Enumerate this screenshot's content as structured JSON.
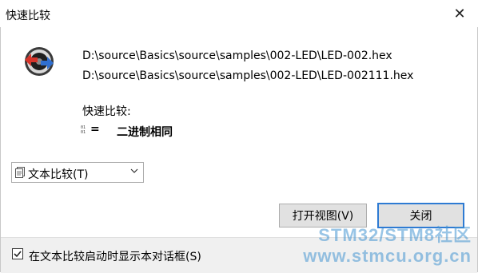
{
  "window": {
    "title": "快速比较",
    "close_glyph": "✕"
  },
  "files": {
    "left": "D:\\source\\Basics\\source\\samples\\002-LED\\LED-002.hex",
    "right": "D:\\source\\Basics\\source\\samples\\002-LED\\LED-002111.hex"
  },
  "summary": {
    "label": "快速比较:",
    "equals_symbol": "=",
    "result": "二进制相同"
  },
  "dropdown": {
    "selected": "文本比较(T)"
  },
  "buttons": {
    "open_view": "打开视图(V)",
    "close": "关闭"
  },
  "footer": {
    "checkbox_checked": true,
    "checkbox_label": "在文本比较启动时显示本对话框(S)"
  },
  "watermark": {
    "line1": "STM32/STM8社区",
    "line2": "www.stmcu.org.cn"
  },
  "colors": {
    "accent": "#2e7bd3",
    "button_bg": "#e1e1e1",
    "footer_bg": "#f0f0f0"
  }
}
